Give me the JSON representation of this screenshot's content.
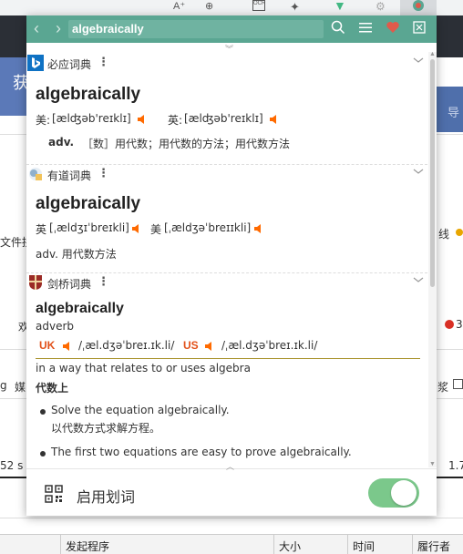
{
  "popup": {
    "query": "algebraically",
    "footer_label": "启用划词",
    "toggle_on": true,
    "accent_color": "#5aa692",
    "speaker_color": "#ff6a00"
  },
  "bing": {
    "name": "必应词典",
    "word": "algebraically",
    "us_label": "美:",
    "us_phonetic": "[ælʤəb'reɪklɪ]",
    "uk_label": "英:",
    "uk_phonetic": "[ælʤəb'reɪklɪ]",
    "pos": "adv.",
    "definition": "［数］用代数；用代数的方法；用代数方法"
  },
  "youdao": {
    "name": "有道词典",
    "word": "algebraically",
    "uk_label": "英",
    "uk_phonetic": "[ˌældʒɪˈbreɪkli]",
    "us_label": "美",
    "us_phonetic": "[ˌældʒəˈbreɪɪkli]",
    "definition": "adv. 用代数方法"
  },
  "cambridge": {
    "name": "剑桥词典",
    "word": "algebraically",
    "pos": "adverb",
    "uk_label": "UK",
    "uk_ipa": "/ˌæl.dʒəˈbreɪ.ɪk.li/",
    "us_label": "US",
    "us_ipa": "/ˌæl.dʒəˈbreɪ.ɪk.li/",
    "definition": "in a way that relates to or uses algebra",
    "zh_definition": "代数上",
    "examples": [
      {
        "en": "Solve the equation algebraically.",
        "zh": "以代数方式求解方程。"
      },
      {
        "en": "The first two equations are easy to prove algebraically.",
        "zh": ""
      }
    ]
  },
  "background": {
    "left_texts": [
      "文件拼",
      "欢",
      "g",
      "媒",
      "52 s"
    ],
    "blue_left": "获",
    "blue_right": "导",
    "right_texts": [
      "线",
      "3",
      "浆",
      "1.7"
    ],
    "table_headers": [
      "发起程序",
      "大小",
      "时间",
      "履行者"
    ]
  }
}
